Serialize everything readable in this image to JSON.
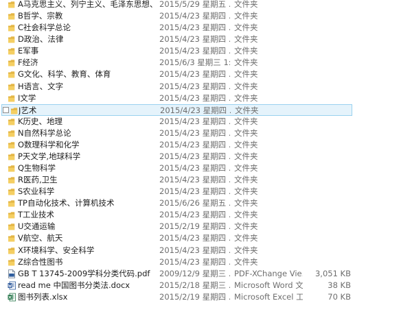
{
  "files": [
    {
      "name": "A马克思主义、列宁主义、毛泽东思想、邓...",
      "date": "2015/5/29 星期五 ...",
      "type": "文件夹",
      "size": "",
      "icon": "folder-icon"
    },
    {
      "name": "B哲学、宗教",
      "date": "2015/4/23 星期四 ...",
      "type": "文件夹",
      "size": "",
      "icon": "folder-icon"
    },
    {
      "name": "C社会科学总论",
      "date": "2015/4/23 星期四 ...",
      "type": "文件夹",
      "size": "",
      "icon": "folder-icon"
    },
    {
      "name": "D政治、法律",
      "date": "2015/4/23 星期四 ...",
      "type": "文件夹",
      "size": "",
      "icon": "folder-icon"
    },
    {
      "name": "E军事",
      "date": "2015/4/23 星期四 ...",
      "type": "文件夹",
      "size": "",
      "icon": "folder-icon"
    },
    {
      "name": "F经济",
      "date": "2015/6/3 星期三 1:...",
      "type": "文件夹",
      "size": "",
      "icon": "folder-icon"
    },
    {
      "name": "G文化、科学、教育、体育",
      "date": "2015/4/23 星期四 ...",
      "type": "文件夹",
      "size": "",
      "icon": "folder-icon"
    },
    {
      "name": "H语言、文字",
      "date": "2015/4/23 星期四 ...",
      "type": "文件夹",
      "size": "",
      "icon": "folder-icon"
    },
    {
      "name": "I文学",
      "date": "2015/4/23 星期四 ...",
      "type": "文件夹",
      "size": "",
      "icon": "folder-icon"
    },
    {
      "name": "J艺术",
      "date": "2015/4/23 星期四 ...",
      "type": "文件夹",
      "size": "",
      "icon": "folder-icon",
      "selected": true
    },
    {
      "name": "K历史、地理",
      "date": "2015/4/23 星期四 ...",
      "type": "文件夹",
      "size": "",
      "icon": "folder-icon"
    },
    {
      "name": "N自然科学总论",
      "date": "2015/4/23 星期四 ...",
      "type": "文件夹",
      "size": "",
      "icon": "folder-icon"
    },
    {
      "name": "O数理科学和化学",
      "date": "2015/4/23 星期四 ...",
      "type": "文件夹",
      "size": "",
      "icon": "folder-icon"
    },
    {
      "name": "P天文学,地球科学",
      "date": "2015/4/23 星期四 ...",
      "type": "文件夹",
      "size": "",
      "icon": "folder-icon"
    },
    {
      "name": "Q生物科学",
      "date": "2015/4/23 星期四 ...",
      "type": "文件夹",
      "size": "",
      "icon": "folder-icon"
    },
    {
      "name": "R医药,卫生",
      "date": "2015/4/23 星期四 ...",
      "type": "文件夹",
      "size": "",
      "icon": "folder-icon"
    },
    {
      "name": "S农业科学",
      "date": "2015/4/23 星期四 ...",
      "type": "文件夹",
      "size": "",
      "icon": "folder-icon"
    },
    {
      "name": "TP自动化技术、计算机技术",
      "date": "2015/6/26 星期五 ...",
      "type": "文件夹",
      "size": "",
      "icon": "folder-icon"
    },
    {
      "name": "T工业技术",
      "date": "2015/4/23 星期四 ...",
      "type": "文件夹",
      "size": "",
      "icon": "folder-icon"
    },
    {
      "name": "U交通运输",
      "date": "2015/2/19 星期四 ...",
      "type": "文件夹",
      "size": "",
      "icon": "folder-icon"
    },
    {
      "name": "V航空、航天",
      "date": "2015/4/23 星期四 ...",
      "type": "文件夹",
      "size": "",
      "icon": "folder-icon"
    },
    {
      "name": "X环境科学、安全科学",
      "date": "2015/4/23 星期四 ...",
      "type": "文件夹",
      "size": "",
      "icon": "folder-icon"
    },
    {
      "name": "Z综合性图书",
      "date": "2015/4/23 星期四 ...",
      "type": "文件夹",
      "size": "",
      "icon": "folder-icon"
    },
    {
      "name": "GB T 13745-2009学科分类代码.pdf",
      "date": "2009/12/9 星期三 ...",
      "type": "PDF-XChange Vie...",
      "size": "3,051 KB",
      "icon": "pdf-file-icon"
    },
    {
      "name": "read me 中国图书分类法.docx",
      "date": "2015/2/18 星期三 ...",
      "type": "Microsoft Word 文...",
      "size": "38 KB",
      "icon": "word-document-icon"
    },
    {
      "name": "图书列表.xlsx",
      "date": "2015/2/19 星期四 ...",
      "type": "Microsoft Excel 工...",
      "size": "70 KB",
      "icon": "excel-spreadsheet-icon"
    }
  ]
}
